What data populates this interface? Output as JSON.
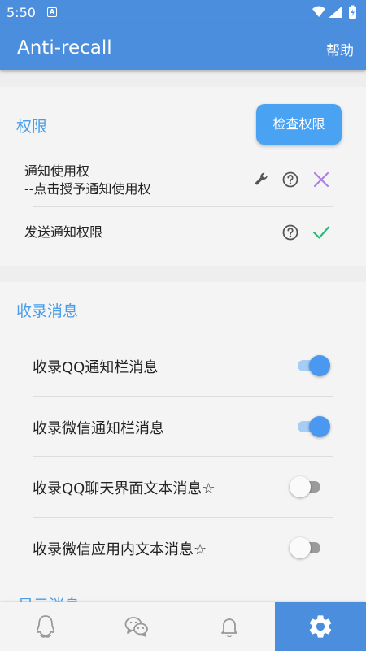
{
  "status_bar": {
    "time": "5:50",
    "notification_glyph": "A"
  },
  "app_bar": {
    "title": "Anti-recall",
    "help": "帮助"
  },
  "permissions": {
    "title": "权限",
    "check_button": "检查权限",
    "items": [
      {
        "label": "通知使用权",
        "sublabel": "--点击授予通知使用权",
        "icons": [
          "wrench-icon",
          "help-icon",
          "cross-icon"
        ]
      },
      {
        "label": "发送通知权限",
        "icons": [
          "help-icon",
          "check-icon"
        ]
      }
    ]
  },
  "collect": {
    "title": "收录消息",
    "items": [
      {
        "label": "收录QQ通知栏消息",
        "enabled": true
      },
      {
        "label": "收录微信通知栏消息",
        "enabled": true
      },
      {
        "label": "收录QQ聊天界面文本消息☆",
        "enabled": false
      },
      {
        "label": "收录微信应用内文本消息☆",
        "enabled": false
      }
    ]
  },
  "next_section_peek": "显示消息",
  "bottom_nav": {
    "items": [
      {
        "icon": "qq-icon",
        "active": false
      },
      {
        "icon": "wechat-icon",
        "active": false
      },
      {
        "icon": "bell-icon",
        "active": false
      },
      {
        "icon": "gear-icon",
        "active": true
      }
    ]
  },
  "colors": {
    "primary": "#4a8edd",
    "accent": "#4a9de8",
    "toggle_on": "#4a98f0",
    "cross": "#b07ee8",
    "check": "#2db87a"
  }
}
